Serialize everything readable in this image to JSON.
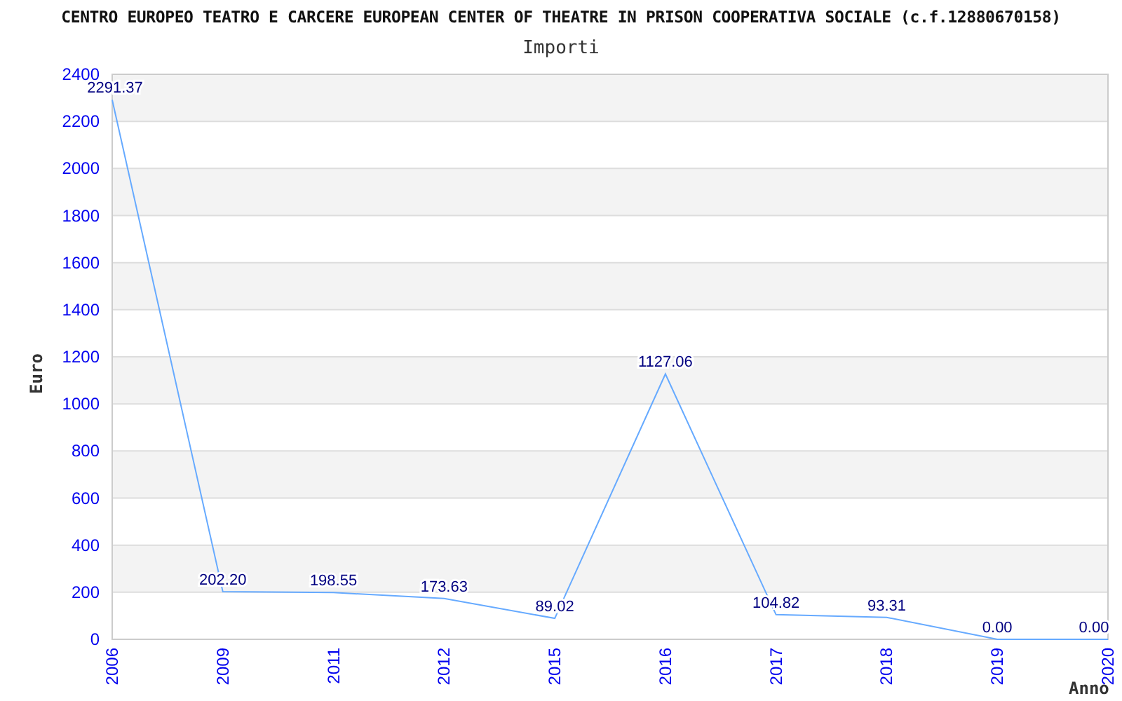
{
  "title": "CENTRO EUROPEO TEATRO E CARCERE EUROPEAN CENTER OF THEATRE IN PRISON COOPERATIVA SOCIALE (c.f.12880670158)",
  "chart_data": {
    "type": "line",
    "title": "Importi",
    "xlabel": "Anno",
    "ylabel": "Euro",
    "grid": true,
    "categories": [
      "2006",
      "2009",
      "2011",
      "2012",
      "2015",
      "2016",
      "2017",
      "2018",
      "2019",
      "2020"
    ],
    "series": [
      {
        "color": "#66aaff",
        "values": [
          2291.37,
          202.2,
          198.55,
          173.63,
          89.02,
          1127.06,
          104.82,
          93.31,
          0.0,
          0.0
        ]
      }
    ],
    "ylim": [
      0,
      2400
    ],
    "yticks": [
      0,
      200,
      400,
      600,
      800,
      1000,
      1200,
      1400,
      1600,
      1800,
      2000,
      2200,
      2400
    ],
    "value_labels": [
      "2291.37",
      "202.20",
      "198.55",
      "173.63",
      "89.02",
      "1127.06",
      "104.82",
      "93.31",
      "0.00",
      "0.00"
    ]
  }
}
